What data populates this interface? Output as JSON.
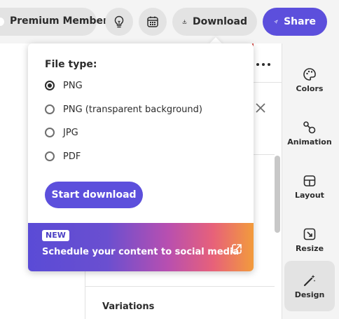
{
  "header": {
    "premium_label": "Premium Member",
    "download_label": "Download",
    "share_label": "Share",
    "ideas_icon": "lightbulb-icon",
    "schedule_icon": "calendar-icon"
  },
  "download_menu": {
    "heading": "File type:",
    "options": [
      {
        "label": "PNG",
        "selected": true
      },
      {
        "label": "PNG (transparent background)",
        "selected": false
      },
      {
        "label": "JPG",
        "selected": false
      },
      {
        "label": "PDF",
        "selected": false
      }
    ],
    "start_button": "Start download",
    "promo": {
      "badge": "NEW",
      "text": "Schedule your content to social media"
    }
  },
  "editor": {
    "variations_label": "Variations"
  },
  "rail": {
    "items": [
      {
        "label": "Colors",
        "icon": "palette-icon",
        "active": false
      },
      {
        "label": "Animation",
        "icon": "animation-icon",
        "active": false
      },
      {
        "label": "Layout",
        "icon": "layout-icon",
        "active": false
      },
      {
        "label": "Resize",
        "icon": "resize-icon",
        "active": false
      },
      {
        "label": "Design",
        "icon": "magic-wand-icon",
        "active": true
      }
    ]
  },
  "colors": {
    "accent": "#5c4fdc",
    "promo_gradient": [
      "#5a4bd6",
      "#b84fb0",
      "#e7617a",
      "#f29b3c"
    ]
  }
}
